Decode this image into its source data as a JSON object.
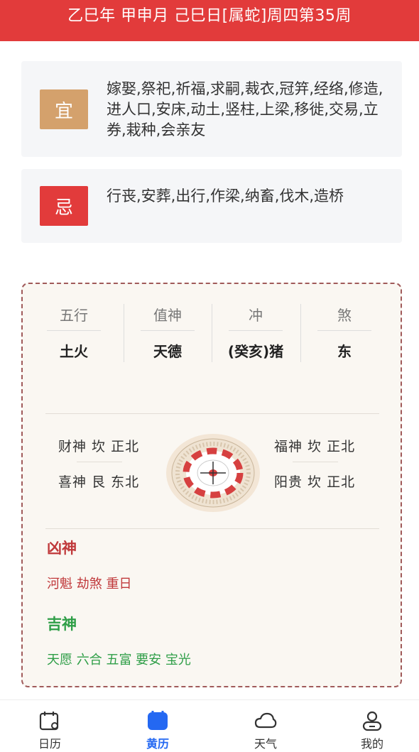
{
  "header": {
    "title": "乙巳年 甲申月 己巳日[属蛇]周四第35周"
  },
  "yi": {
    "badge": "宜",
    "text": "嫁娶,祭祀,祈福,求嗣,裁衣,冠笄,经络,修造,进人口,安床,动土,竖柱,上梁,移徙,交易,立券,栽种,会亲友"
  },
  "ji": {
    "badge": "忌",
    "text": "行丧,安葬,出行,作梁,纳畜,伐木,造桥"
  },
  "attrs": [
    {
      "label": "五行",
      "value": "土火"
    },
    {
      "label": "值神",
      "value": "天德"
    },
    {
      "label": "冲",
      "value": "(癸亥)猪"
    },
    {
      "label": "煞",
      "value": "东"
    }
  ],
  "gods": {
    "wealth": "财神 坎 正北",
    "joy": "喜神 艮 东北",
    "fortune": "福神 坎 正北",
    "yanggui": "阳贵 坎 正北"
  },
  "evil": {
    "title": "凶神",
    "items": "河魁 劫煞 重日"
  },
  "good": {
    "title": "吉神",
    "items": "天愿 六合 五富 要安 宝光"
  },
  "colors": {
    "header": "#e23b3b",
    "yi_badge": "#d4a16c",
    "ji_badge": "#e23b3b",
    "evil": "#c0393b",
    "good": "#2e9e47",
    "active_tab": "#2468f2"
  },
  "tabs": [
    {
      "label": "日历",
      "icon": "calendar-icon",
      "active": false
    },
    {
      "label": "黄历",
      "icon": "almanac-icon",
      "active": true
    },
    {
      "label": "天气",
      "icon": "weather-cloud-icon",
      "active": false
    },
    {
      "label": "我的",
      "icon": "profile-icon",
      "active": false
    }
  ]
}
